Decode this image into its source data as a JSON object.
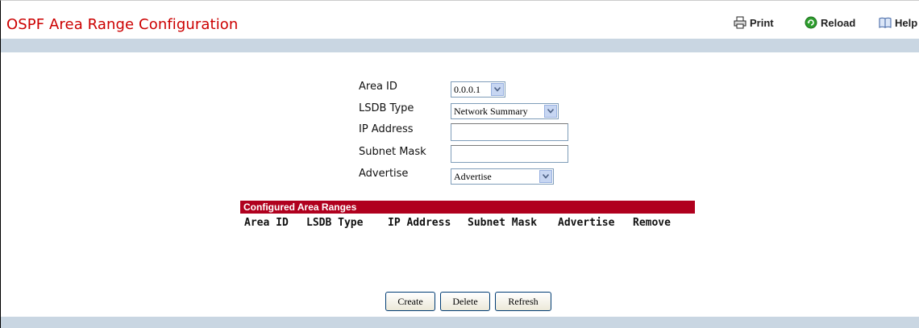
{
  "header": {
    "title": "OSPF Area Range Configuration",
    "print_label": "Print",
    "reload_label": "Reload",
    "help_label": "Help"
  },
  "form": {
    "area_id": {
      "label": "Area ID",
      "value": "0.0.0.1"
    },
    "lsdb_type": {
      "label": "LSDB Type",
      "value": "Network Summary"
    },
    "ip_address": {
      "label": "IP Address",
      "value": ""
    },
    "subnet_mask": {
      "label": "Subnet Mask",
      "value": ""
    },
    "advertise": {
      "label": "Advertise",
      "value": "Advertise"
    }
  },
  "table": {
    "title": "Configured Area Ranges",
    "columns": [
      "Area ID",
      "LSDB Type",
      "IP Address",
      "Subnet Mask",
      "Advertise",
      "Remove"
    ],
    "rows": []
  },
  "actions": {
    "create_label": "Create",
    "delete_label": "Delete",
    "refresh_label": "Refresh"
  },
  "colors": {
    "title": "#cc0000",
    "band": "#c9d6e2",
    "table_header": "#b0001e"
  }
}
